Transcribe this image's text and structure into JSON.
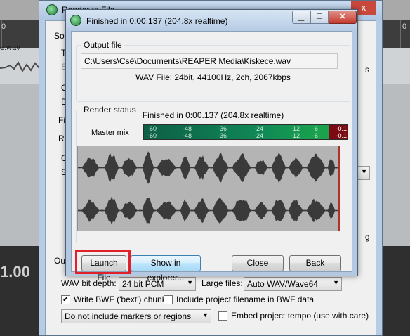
{
  "background": {
    "ruler_ticks": [
      "0",
      "0"
    ],
    "track_file": "e.wav",
    "time_display": "1.00"
  },
  "render_window": {
    "title": "Render to File",
    "close_glyph": "x",
    "left_labels": [
      "Sou",
      "T",
      "S",
      "O",
      "D",
      "Fil",
      "Re",
      "O",
      "Se",
      "R",
      "Outp"
    ],
    "right_labels": [
      "s",
      "g"
    ],
    "wav_bit_depth_label": "WAV bit depth:",
    "wav_bit_depth_value": "24 bit PCM",
    "large_files_label": "Large files:",
    "large_files_value": "Auto WAV/Wave64",
    "bwf_chunk_label": "Write BWF ('bext') chunk",
    "bwf_chunk_checked": true,
    "include_filename_label": "Include project filename in BWF data",
    "include_filename_checked": false,
    "markers_value": "Do not include markers or regions",
    "embed_tempo_label": "Embed project tempo (use with care)",
    "embed_tempo_checked": false
  },
  "dialog": {
    "title": "Finished in 0:00.137 (204.8x realtime)",
    "minimize_glyph": "▁",
    "maximize_glyph": "☐",
    "close_glyph": "✕",
    "output_group_label": "Output file",
    "output_path": "C:\\Users\\Csé\\Documents\\REAPER Media\\Kiskece.wav",
    "wav_info": "WAV File: 24bit, 44100Hz, 2ch, 2067kbps",
    "status_group_label": "Render status",
    "status_text": "Finished in 0:00.137 (204.8x realtime)",
    "master_mix_label": "Master mix",
    "meter_ticks": [
      "-60",
      "-48",
      "-36",
      "-24",
      "-12",
      "-6"
    ],
    "meter_peak_l": "-0.1",
    "meter_peak_r": "-0.1",
    "meter_level_fraction": 0.91,
    "launch_button": "Launch File",
    "explorer_button": "Show in explorer...",
    "close_button": "Close",
    "back_button": "Back"
  },
  "colors": {
    "highlight": "#e2202c",
    "meter_green": "#108a57",
    "meter_red": "#7a0b12",
    "waveform": "#3a3a3a",
    "waveform_bg": "#b4b4b4"
  }
}
